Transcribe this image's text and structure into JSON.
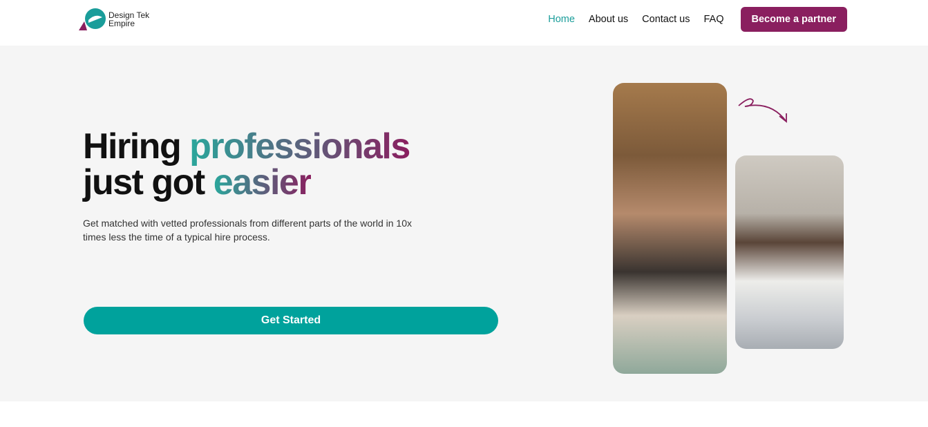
{
  "brand": {
    "name_line1": "Design Tek",
    "name_line2": "Empire"
  },
  "nav": {
    "items": [
      {
        "label": "Home",
        "active": true
      },
      {
        "label": "About us"
      },
      {
        "label": "Contact us"
      },
      {
        "label": "FAQ"
      }
    ],
    "cta": "Become a partner"
  },
  "hero": {
    "title_part1": "Hiring ",
    "title_highlight1": "professionals",
    "title_part2": "just got ",
    "title_highlight2": "easier",
    "subtitle": "Get matched with vetted professionals from different parts of the world in 10x times less the time of a typical hire process.",
    "cta": "Get Started"
  },
  "colors": {
    "accent": "#00a29c",
    "brand": "#8a1f5f"
  }
}
